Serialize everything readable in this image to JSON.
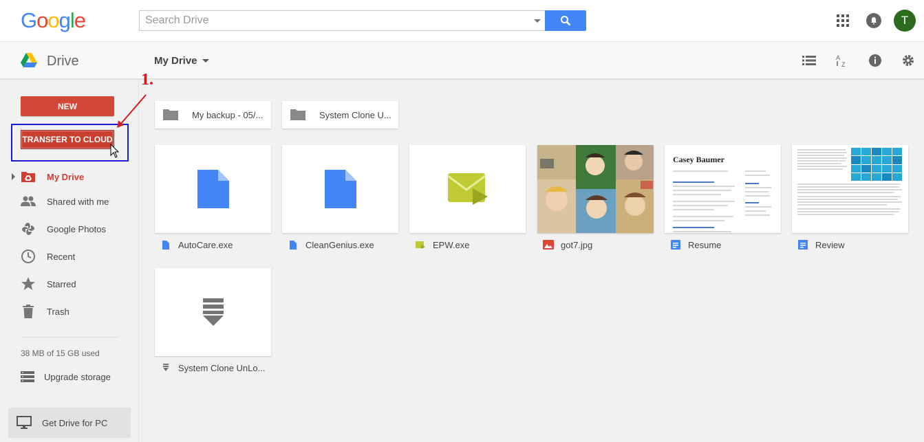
{
  "header": {
    "logo_letters": [
      {
        "char": "G",
        "color": "#4285f4"
      },
      {
        "char": "o",
        "color": "#ea4335"
      },
      {
        "char": "o",
        "color": "#fbbc05"
      },
      {
        "char": "g",
        "color": "#4285f4"
      },
      {
        "char": "l",
        "color": "#34a853"
      },
      {
        "char": "e",
        "color": "#ea4335"
      }
    ],
    "search_placeholder": "Search Drive",
    "avatar_initial": "T"
  },
  "subheader": {
    "app_name": "Drive",
    "location_title": "My Drive",
    "icons": [
      "list-view-icon",
      "sort-az-icon",
      "info-icon",
      "settings-icon"
    ]
  },
  "sidebar": {
    "new_button": "NEW",
    "transfer_button": "TRANSFER TO CLOUD",
    "items": [
      {
        "label": "My Drive",
        "icon": "my-drive-icon",
        "active": true
      },
      {
        "label": "Shared with me",
        "icon": "shared-people-icon"
      },
      {
        "label": "Google Photos",
        "icon": "photos-pinwheel-icon"
      },
      {
        "label": "Recent",
        "icon": "clock-icon"
      },
      {
        "label": "Starred",
        "icon": "star-icon"
      },
      {
        "label": "Trash",
        "icon": "trash-icon"
      }
    ],
    "storage_text": "38 MB of 15 GB used",
    "upgrade_label": "Upgrade storage",
    "get_drive_label": "Get Drive for PC"
  },
  "annotation": {
    "step": "1."
  },
  "folders": [
    {
      "name": "My backup - 05/..."
    },
    {
      "name": "System Clone U..."
    }
  ],
  "files": [
    {
      "name": "AutoCare.exe",
      "type": "file"
    },
    {
      "name": "CleanGenius.exe",
      "type": "file"
    },
    {
      "name": "EPW.exe",
      "type": "video"
    },
    {
      "name": "got7.jpg",
      "type": "image"
    },
    {
      "name": "Resume",
      "type": "doc"
    },
    {
      "name": "Review",
      "type": "doc"
    },
    {
      "name": "System Clone UnLo...",
      "type": "archive"
    }
  ],
  "resume_preview_name": "Casey Baumer",
  "colors": {
    "accent_red": "#d14836",
    "search_blue": "#4285f4",
    "annotation_red": "#d41a1a",
    "highlight_box": "#1a1ad6"
  }
}
